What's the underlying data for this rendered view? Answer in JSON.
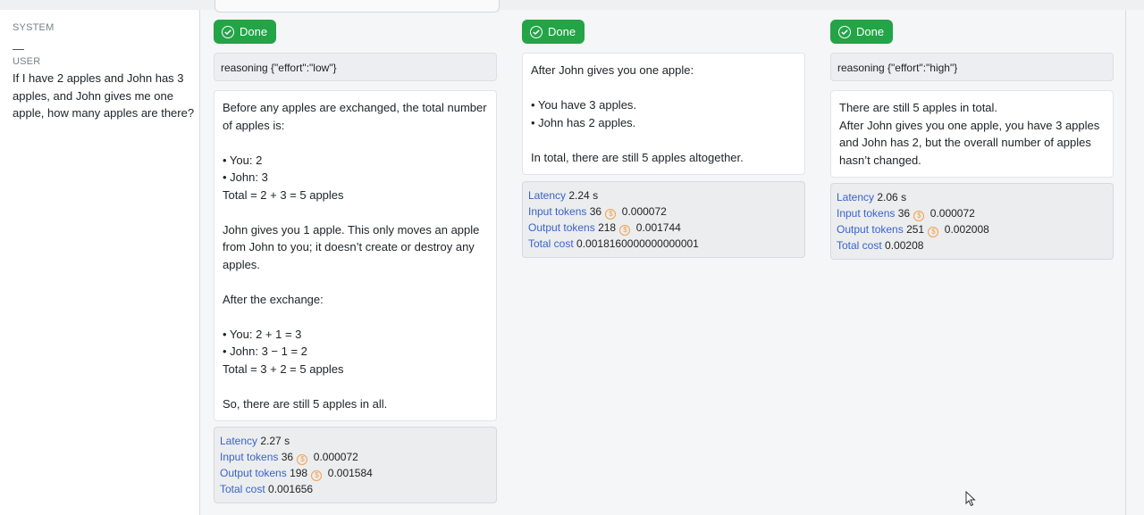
{
  "left": {
    "system_label": "SYSTEM",
    "system_value": "—",
    "user_label": "USER",
    "user_message": "If I have 2 apples and John has 3 apples, and John gives me one apple, how many apples are there?"
  },
  "columns": [
    {
      "status": "Done",
      "reasoning": "reasoning {\"effort\":\"low\"}",
      "output": [
        "Before any apples are exchanged, the total number of apples is:",
        "",
        "• You: 2",
        "• John: 3",
        "Total = 2 + 3 = 5 apples",
        "",
        "John gives you 1 apple. This only moves an apple from John to you; it doesn’t create or destroy any apples.",
        "",
        "After the exchange:",
        "",
        "• You: 2 + 1 = 3",
        "• John: 3 − 1 = 2",
        "Total = 3 + 2 = 5 apples",
        "",
        "So, there are still 5 apples in all."
      ],
      "metrics": {
        "latency_label": "Latency",
        "latency": "2.27 s",
        "input_label": "Input tokens",
        "input_tokens": "36",
        "input_cost": "0.000072",
        "output_label": "Output tokens",
        "output_tokens": "198",
        "output_cost": "0.001584",
        "total_label": "Total cost",
        "total_cost": "0.001656"
      }
    },
    {
      "status": "Done",
      "reasoning": "",
      "output": [
        "After John gives you one apple:",
        "",
        "• You have 3 apples.",
        "• John has 2 apples.",
        "",
        "In total, there are still 5 apples altogether."
      ],
      "metrics": {
        "latency_label": "Latency",
        "latency": "2.24 s",
        "input_label": "Input tokens",
        "input_tokens": "36",
        "input_cost": "0.000072",
        "output_label": "Output tokens",
        "output_tokens": "218",
        "output_cost": "0.001744",
        "total_label": "Total cost",
        "total_cost": "0.0018160000000000001"
      }
    },
    {
      "status": "Done",
      "reasoning": "reasoning {\"effort\":\"high\"}",
      "output": [
        "There are still 5 apples in total.",
        "After John gives you one apple, you have 3 apples and John has 2, but the overall number of apples hasn’t changed."
      ],
      "metrics": {
        "latency_label": "Latency",
        "latency": "2.06 s",
        "input_label": "Input tokens",
        "input_tokens": "36",
        "input_cost": "0.000072",
        "output_label": "Output tokens",
        "output_tokens": "251",
        "output_cost": "0.002008",
        "total_label": "Total cost",
        "total_cost": "0.00208"
      }
    }
  ],
  "colors": {
    "done": "#22a447",
    "metric_key": "#3b62c8",
    "coin": "#f3a14b"
  },
  "icons": {
    "status": "check-circle-icon",
    "cost": "dollar-coin-icon",
    "pointer": "mouse-cursor-icon"
  }
}
